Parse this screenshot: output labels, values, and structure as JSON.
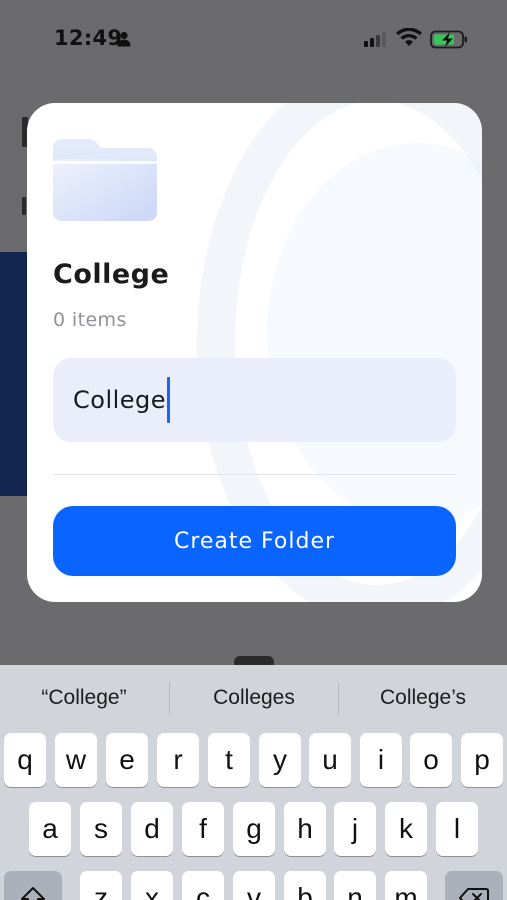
{
  "status_bar": {
    "time": "12:49"
  },
  "modal": {
    "folder_name": "College",
    "item_count": "0 items",
    "name_field_value": "College",
    "create_button_label": "Create Folder"
  },
  "keyboard": {
    "suggestions": [
      "“College”",
      "Colleges",
      "College’s"
    ],
    "row1": [
      "q",
      "w",
      "e",
      "r",
      "t",
      "y",
      "u",
      "i",
      "o",
      "p"
    ],
    "row2": [
      "a",
      "s",
      "d",
      "f",
      "g",
      "h",
      "j",
      "k",
      "l"
    ],
    "row3": [
      "z",
      "x",
      "c",
      "v",
      "b",
      "n",
      "m"
    ]
  },
  "colors": {
    "accent": "#0a64ff",
    "field_bg": "#e9eefa",
    "caret": "#1a63ff"
  }
}
